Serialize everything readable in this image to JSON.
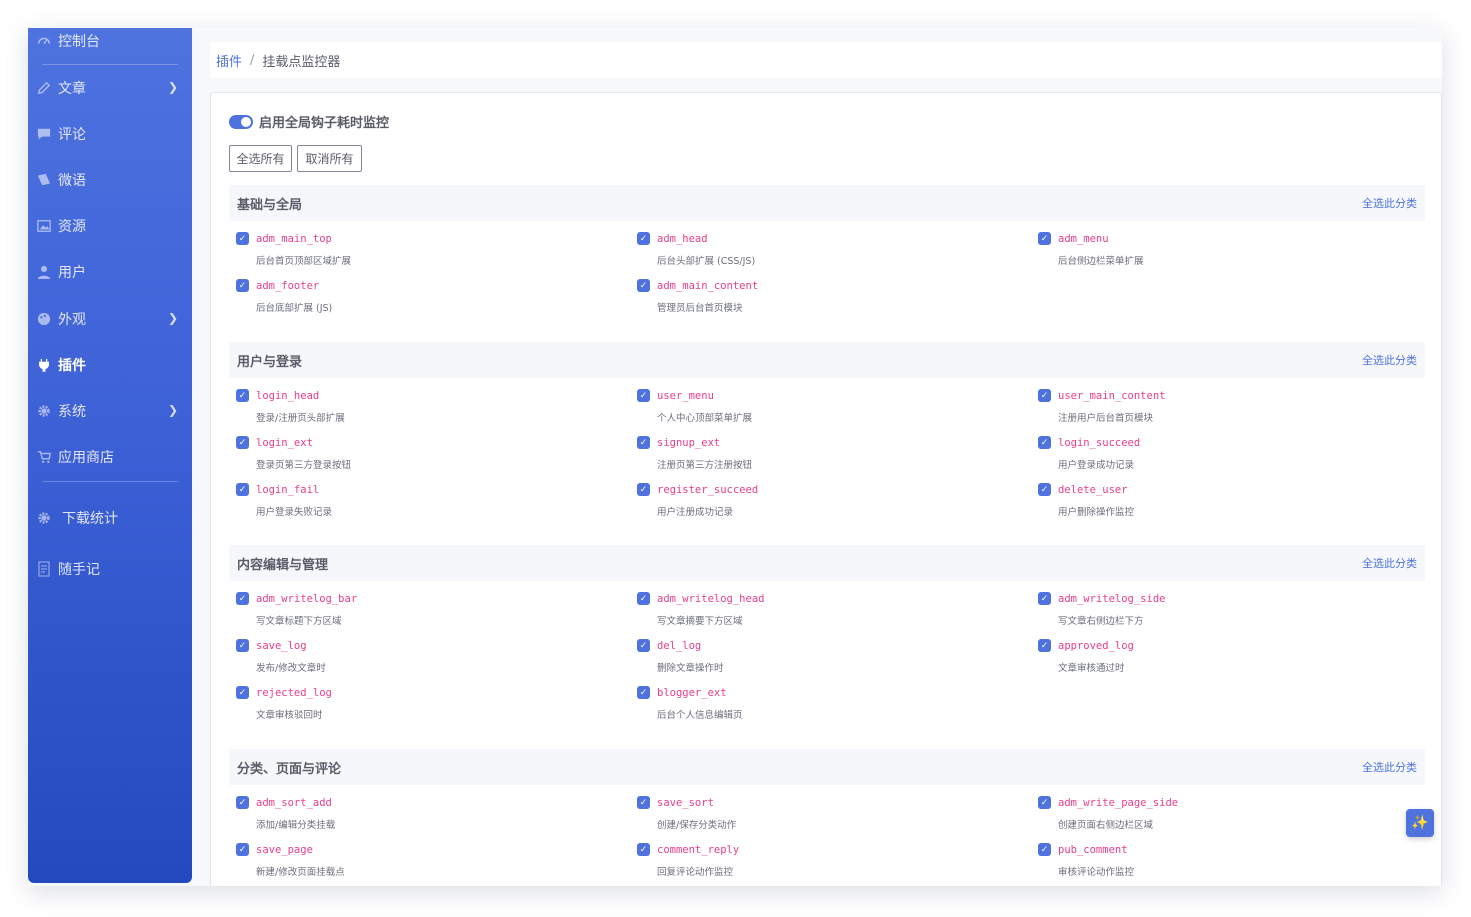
{
  "sidebar": {
    "items": [
      {
        "label": "控制台",
        "icon": "dashboard-icon"
      },
      {
        "label": "文章",
        "icon": "pencil-icon"
      },
      {
        "label": "评论",
        "icon": "comment-icon"
      },
      {
        "label": "微语",
        "icon": "note-icon"
      },
      {
        "label": "资源",
        "icon": "image-icon"
      },
      {
        "label": "用户",
        "icon": "user-icon"
      },
      {
        "label": "外观",
        "icon": "palette-icon"
      },
      {
        "label": "插件",
        "icon": "plug-icon"
      },
      {
        "label": "系统",
        "icon": "gear-icon"
      },
      {
        "label": "应用商店",
        "icon": "cart-icon"
      },
      {
        "label": "下载统计",
        "icon": "gear-icon"
      },
      {
        "label": "随手记",
        "icon": "notepad-icon"
      }
    ],
    "active": "插件"
  },
  "breadcrumb": {
    "parent": "插件",
    "separator": "/",
    "current": "挂载点监控器"
  },
  "toggle": {
    "label": "启用全局钩子耗时监控",
    "enabled": true
  },
  "buttons": {
    "select_all": "全选所有",
    "deselect_all": "取消所有"
  },
  "select_category_label": "全选此分类",
  "sections": [
    {
      "title": "基础与全局",
      "hooks": [
        {
          "name": "adm_main_top",
          "desc": "后台首页顶部区域扩展"
        },
        {
          "name": "adm_head",
          "desc": "后台头部扩展 (CSS/JS)"
        },
        {
          "name": "adm_menu",
          "desc": "后台侧边栏菜单扩展"
        },
        {
          "name": "adm_footer",
          "desc": "后台底部扩展 (JS)"
        },
        {
          "name": "adm_main_content",
          "desc": "管理员后台首页模块"
        }
      ]
    },
    {
      "title": "用户与登录",
      "hooks": [
        {
          "name": "login_head",
          "desc": "登录/注册页头部扩展"
        },
        {
          "name": "user_menu",
          "desc": "个人中心顶部菜单扩展"
        },
        {
          "name": "user_main_content",
          "desc": "注册用户后台首页模块"
        },
        {
          "name": "login_ext",
          "desc": "登录页第三方登录按钮"
        },
        {
          "name": "signup_ext",
          "desc": "注册页第三方注册按钮"
        },
        {
          "name": "login_succeed",
          "desc": "用户登录成功记录"
        },
        {
          "name": "login_fail",
          "desc": "用户登录失败记录"
        },
        {
          "name": "register_succeed",
          "desc": "用户注册成功记录"
        },
        {
          "name": "delete_user",
          "desc": "用户删除操作监控"
        }
      ]
    },
    {
      "title": "内容编辑与管理",
      "hooks": [
        {
          "name": "adm_writelog_bar",
          "desc": "写文章标题下方区域"
        },
        {
          "name": "adm_writelog_head",
          "desc": "写文章摘要下方区域"
        },
        {
          "name": "adm_writelog_side",
          "desc": "写文章右侧边栏下方"
        },
        {
          "name": "save_log",
          "desc": "发布/修改文章时"
        },
        {
          "name": "del_log",
          "desc": "删除文章操作时"
        },
        {
          "name": "approved_log",
          "desc": "文章审核通过时"
        },
        {
          "name": "rejected_log",
          "desc": "文章审核驳回时"
        },
        {
          "name": "blogger_ext",
          "desc": "后台个人信息编辑页"
        }
      ]
    },
    {
      "title": "分类、页面与评论",
      "hooks": [
        {
          "name": "adm_sort_add",
          "desc": "添加/编辑分类挂载"
        },
        {
          "name": "save_sort",
          "desc": "创建/保存分类动作"
        },
        {
          "name": "adm_write_page_side",
          "desc": "创建页面右侧边栏区域"
        },
        {
          "name": "save_page",
          "desc": "新建/修改页面挂载点"
        },
        {
          "name": "comment_reply",
          "desc": "回复评论动作监控"
        },
        {
          "name": "pub_comment",
          "desc": "审核评论动作监控"
        }
      ]
    }
  ],
  "fab": {
    "icon": "sparkle-icon",
    "glyph": "✨"
  },
  "colors": {
    "accent": "#4e73df",
    "hook_name": "#e83e8c",
    "sidebar_top": "#4e73df",
    "sidebar_bottom": "#224abe"
  }
}
